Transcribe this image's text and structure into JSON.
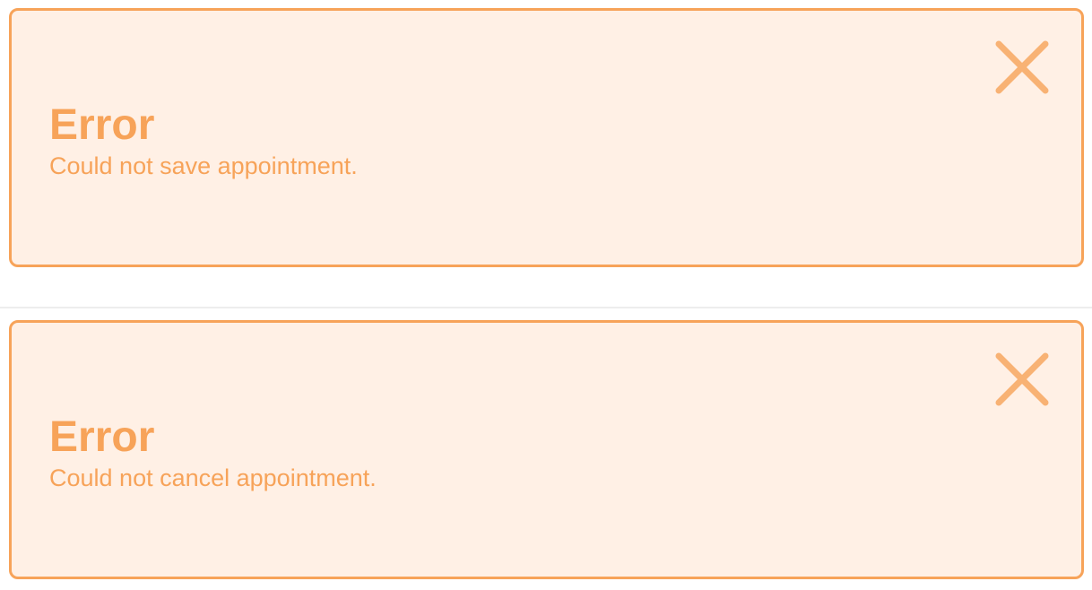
{
  "alerts": [
    {
      "title": "Error",
      "message": "Could not save appointment.",
      "close_icon": "close-icon"
    },
    {
      "title": "Error",
      "message": "Could not cancel appointment.",
      "close_icon": "close-icon"
    }
  ],
  "colors": {
    "alert_background": "#fff0e5",
    "alert_border": "#f7a359",
    "alert_text": "#f7a359",
    "divider": "#ededed"
  }
}
